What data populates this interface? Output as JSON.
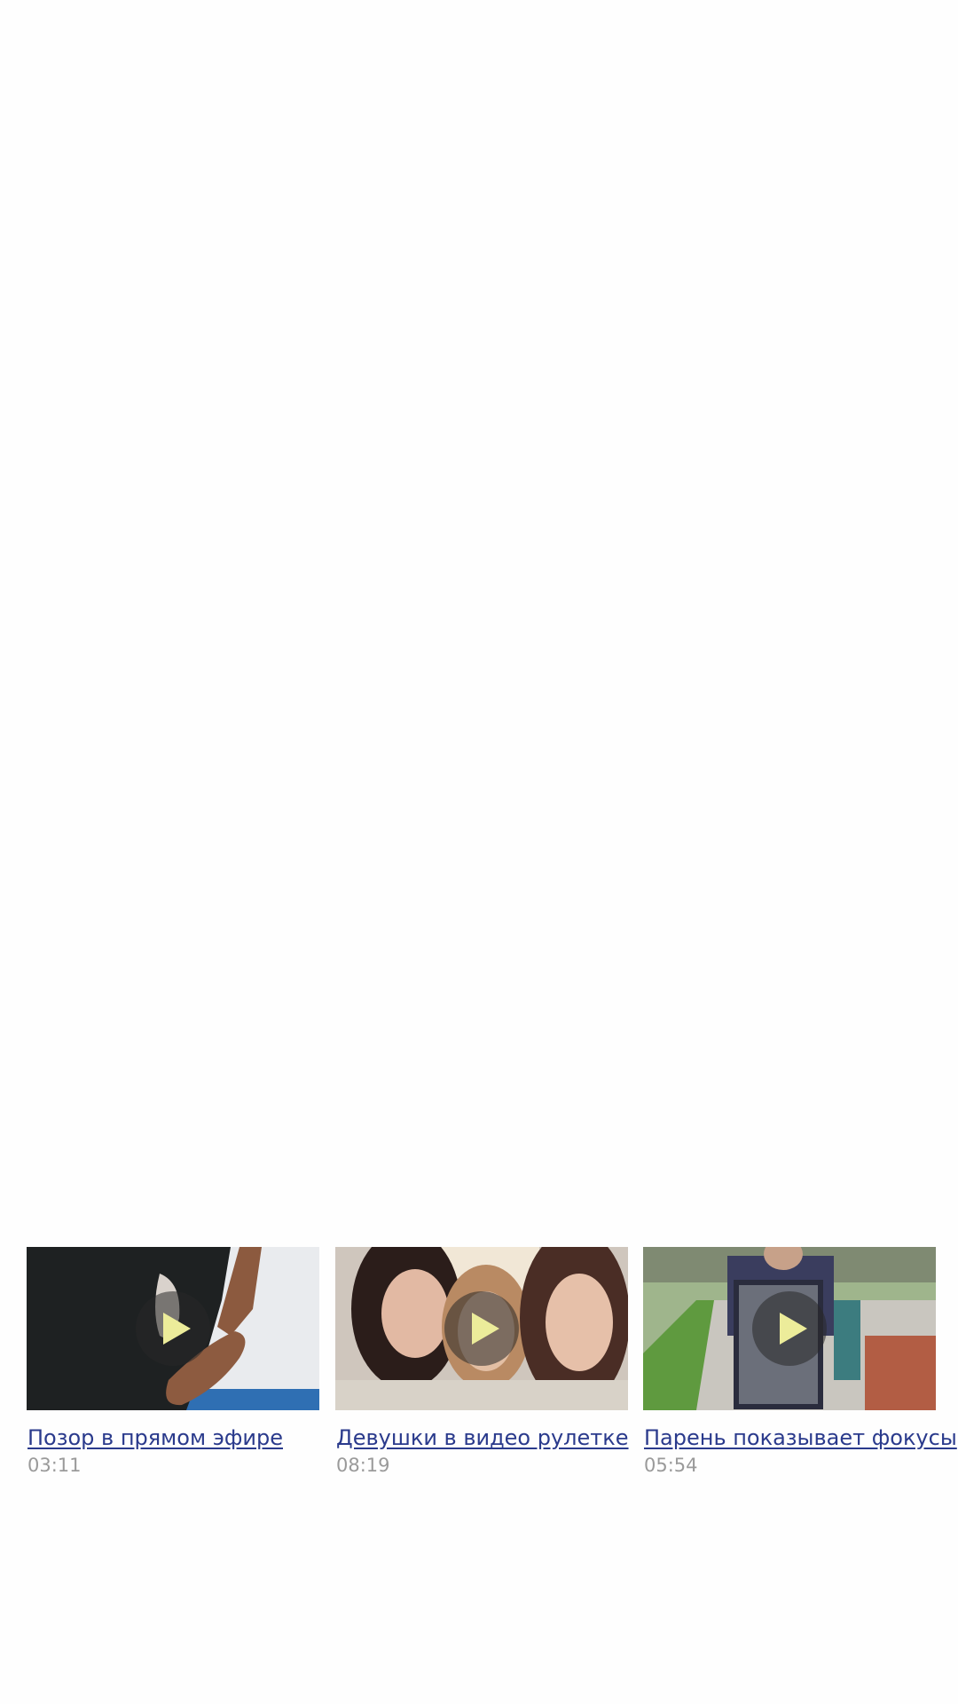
{
  "colors": {
    "background": "#fefefe",
    "link": "#2a3a8c",
    "duration": "#9a9a9a",
    "play_icon": "#ecec9a",
    "play_circle": "rgba(40,40,40,0.55)"
  },
  "videos": [
    {
      "title": "Позор в прямом эфире",
      "duration": "03:11",
      "thumbnail_icon": "play-icon"
    },
    {
      "title": "Девушки в видео рулетке",
      "duration": "08:19",
      "thumbnail_icon": "play-icon"
    },
    {
      "title": "Парень показывает фокусы",
      "duration": "05:54",
      "thumbnail_icon": "play-icon"
    }
  ]
}
